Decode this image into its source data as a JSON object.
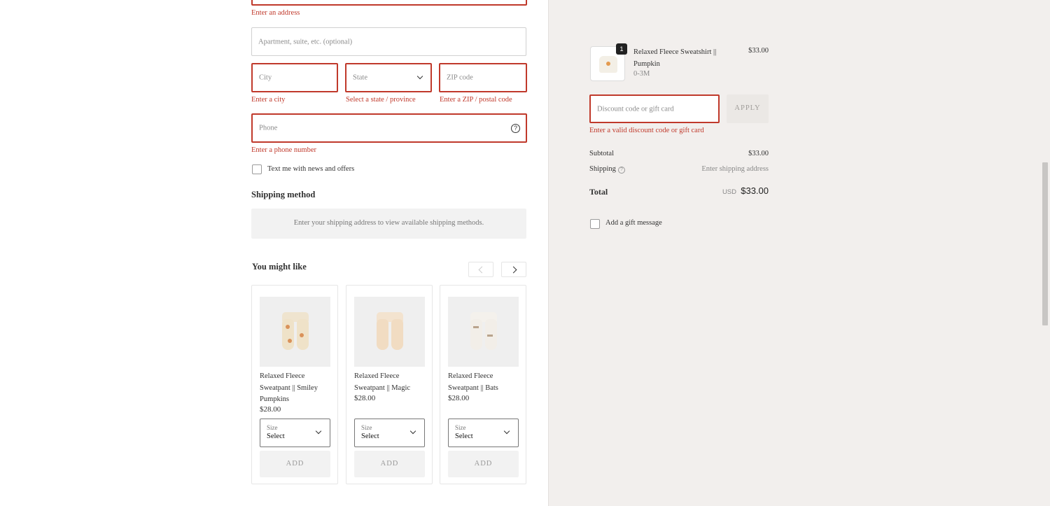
{
  "form": {
    "address_error": "Enter an address",
    "apartment_placeholder": "Apartment, suite, etc. (optional)",
    "city_placeholder": "City",
    "city_error": "Enter a city",
    "state_placeholder": "State",
    "state_error": "Select a state / province",
    "zip_placeholder": "ZIP code",
    "zip_error": "Enter a ZIP / postal code",
    "phone_placeholder": "Phone",
    "phone_error": "Enter a phone number",
    "sms_label": "Text me with news and offers"
  },
  "shipping": {
    "title": "Shipping method",
    "message": "Enter your shipping address to view available shipping methods."
  },
  "recommendations": {
    "title": "You might like",
    "items": [
      {
        "name": "Relaxed Fleece Sweatpant || Smiley Pumpkins",
        "price": "$28.00",
        "size_label": "Size",
        "size_value": "Select",
        "add_label": "ADD"
      },
      {
        "name": "Relaxed Fleece Sweatpant || Magic",
        "price": "$28.00",
        "size_label": "Size",
        "size_value": "Select",
        "add_label": "ADD"
      },
      {
        "name": "Relaxed Fleece Sweatpant || Bats",
        "price": "$28.00",
        "size_label": "Size",
        "size_value": "Select",
        "add_label": "ADD"
      }
    ]
  },
  "summary": {
    "item": {
      "quantity": "1",
      "name": "Relaxed Fleece Sweatshirt || Pumpkin",
      "variant": "0-3M",
      "price": "$33.00"
    },
    "discount_placeholder": "Discount code or gift card",
    "apply_label": "APPLY",
    "discount_error": "Enter a valid discount code or gift card",
    "subtotal_label": "Subtotal",
    "subtotal_value": "$33.00",
    "shipping_label": "Shipping",
    "shipping_value": "Enter shipping address",
    "total_label": "Total",
    "currency": "USD",
    "total_value": "$33.00",
    "gift_label": "Add a gift message"
  },
  "colors": {
    "error": "#c0392b",
    "sidebar_bg": "#f2efed"
  }
}
